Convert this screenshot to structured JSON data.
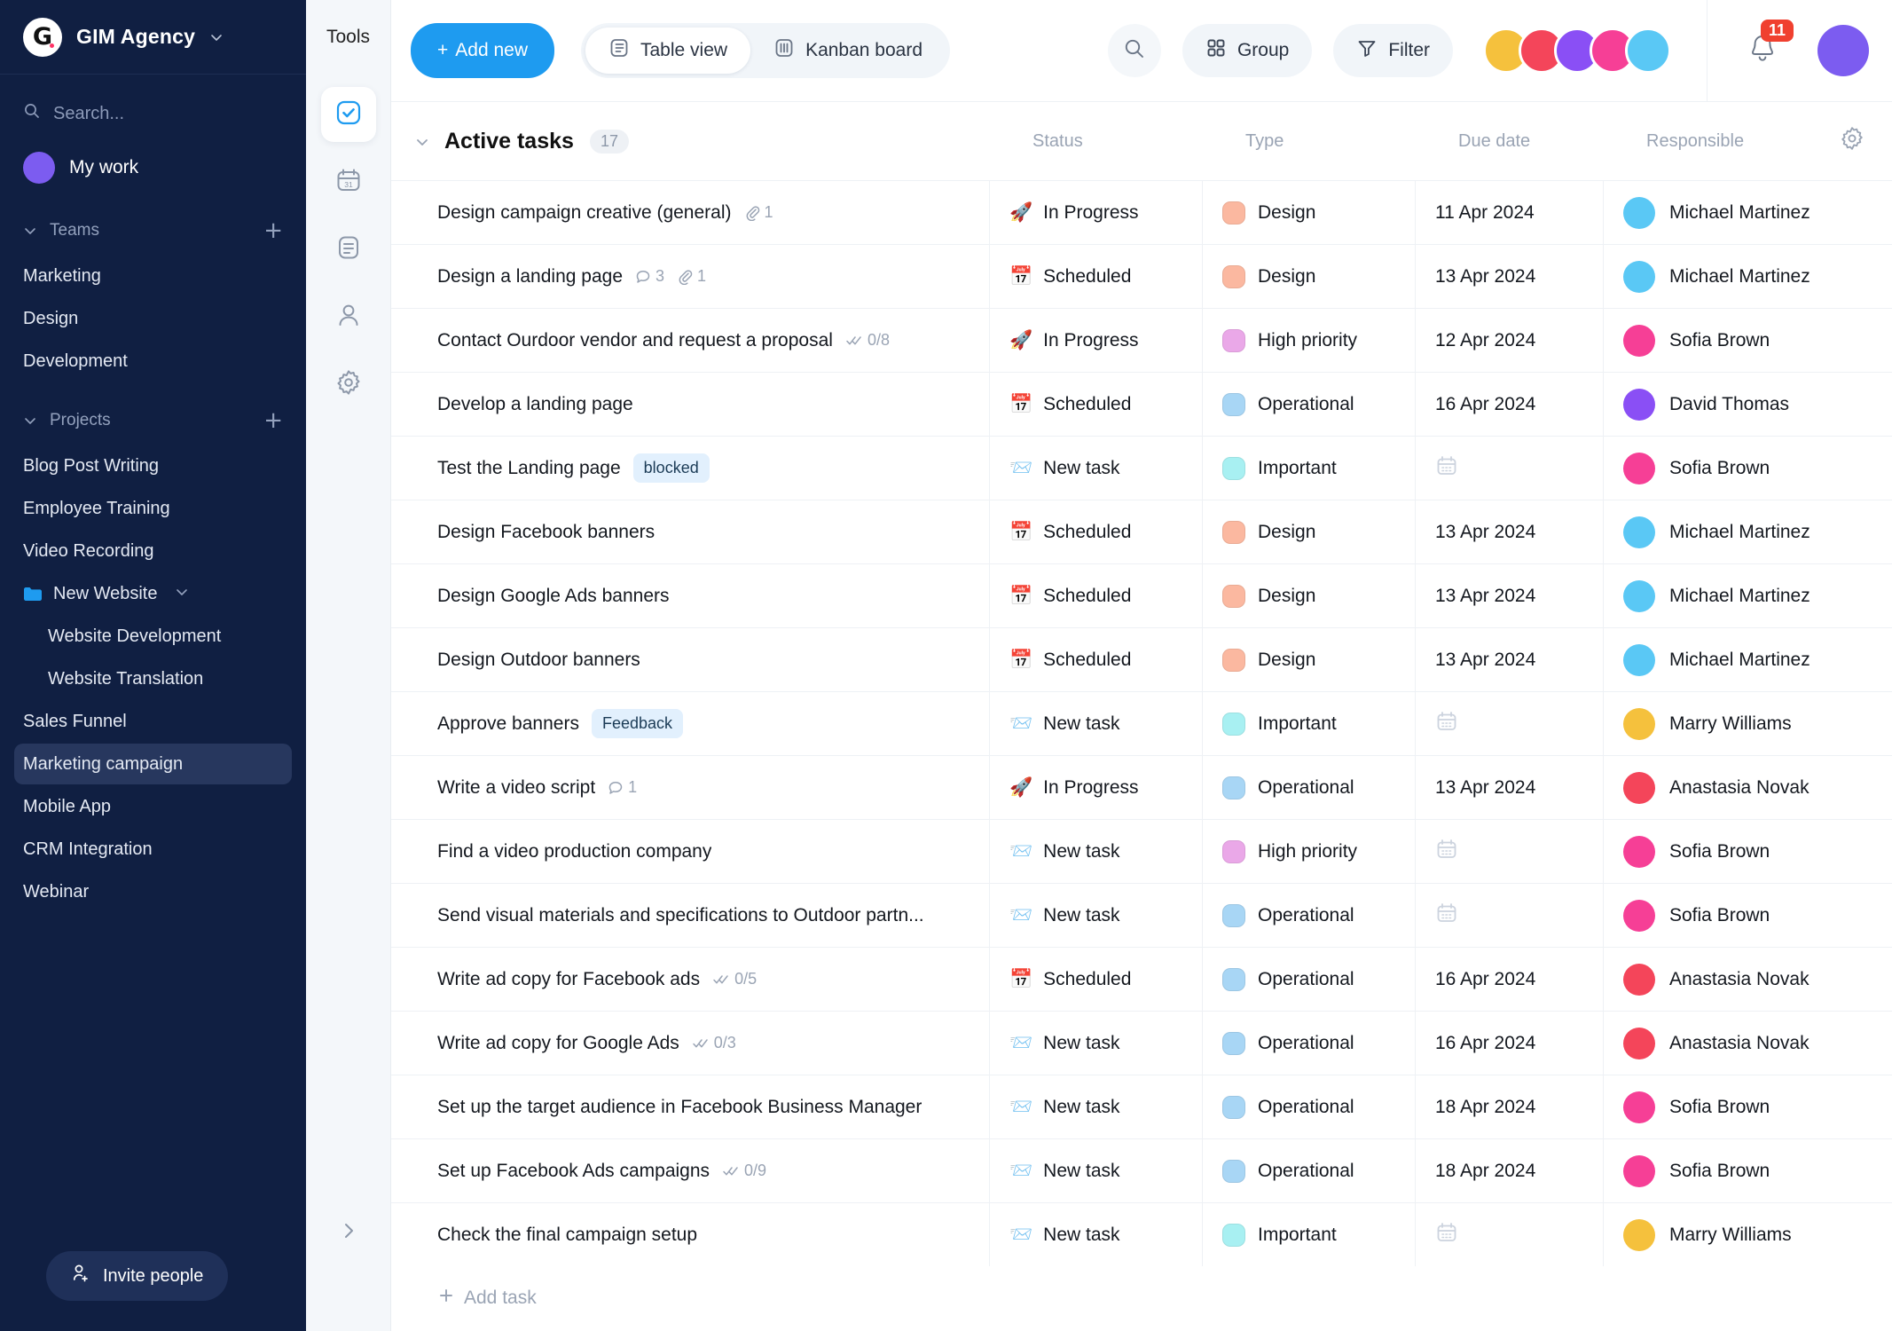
{
  "sidebar": {
    "brand": {
      "logo_letter": "G",
      "name": "GIM Agency",
      "chevron_icon": "chevron-down-icon"
    },
    "search": {
      "placeholder": "Search...",
      "icon": "search-icon"
    },
    "my_work": {
      "label": "My work",
      "avatar_color": "#7c5cf0"
    },
    "teams": {
      "label": "Teams",
      "add_label": "+",
      "items": [
        {
          "label": "Marketing"
        },
        {
          "label": "Design"
        },
        {
          "label": "Development"
        }
      ]
    },
    "projects": {
      "label": "Projects",
      "add_label": "+",
      "items": [
        {
          "label": "Blog Post Writing",
          "level": 0,
          "folder": false,
          "active": false
        },
        {
          "label": "Employee Training",
          "level": 0,
          "folder": false,
          "active": false
        },
        {
          "label": "Video Recording",
          "level": 0,
          "folder": false,
          "active": false
        },
        {
          "label": "New Website",
          "level": 0,
          "folder": true,
          "active": false
        },
        {
          "label": "Website Development",
          "level": 1,
          "folder": false,
          "active": false
        },
        {
          "label": "Website Translation",
          "level": 1,
          "folder": false,
          "active": false
        },
        {
          "label": "Sales Funnel",
          "level": 0,
          "folder": false,
          "active": false
        },
        {
          "label": "Marketing campaign",
          "level": 0,
          "folder": false,
          "active": true
        },
        {
          "label": "Mobile App",
          "level": 0,
          "folder": false,
          "active": false
        },
        {
          "label": "CRM Integration",
          "level": 0,
          "folder": false,
          "active": false
        },
        {
          "label": "Webinar",
          "level": 0,
          "folder": false,
          "active": false
        }
      ]
    },
    "invite": {
      "label": "Invite people",
      "icon": "add-person-icon"
    }
  },
  "rail": {
    "title": "Tools",
    "items": [
      {
        "icon": "checkbox-tasks-icon",
        "selected": true
      },
      {
        "icon": "calendar-31-icon",
        "selected": false
      },
      {
        "icon": "document-icon",
        "selected": false
      },
      {
        "icon": "person-icon",
        "selected": false
      },
      {
        "icon": "gear-icon",
        "selected": false
      }
    ],
    "collapse_icon": "chevron-right-icon"
  },
  "topbar": {
    "add_new": {
      "label": "Add new",
      "plus": "+"
    },
    "views": [
      {
        "label": "Table view",
        "icon": "table-view-icon",
        "active": true
      },
      {
        "label": "Kanban board",
        "icon": "kanban-board-icon",
        "active": false
      }
    ],
    "search_icon": "search-icon",
    "group": {
      "label": "Group",
      "icon": "grid-icon"
    },
    "filter": {
      "label": "Filter",
      "icon": "funnel-icon"
    },
    "member_avatars": [
      "#f5c13d",
      "#f4455a",
      "#8a4ff5",
      "#f63f96",
      "#5ac8f5"
    ],
    "bell": {
      "icon": "bell-icon",
      "count": "11",
      "badge_color": "#f0402f"
    },
    "profile_avatar": {
      "color": "#7c5cf0"
    },
    "accent_color": "#1e9bf0"
  },
  "table": {
    "section_title": "Active tasks",
    "section_count": "17",
    "collapse_icon": "chevron-down-icon",
    "settings_icon": "gear-icon",
    "columns": [
      "",
      "Status",
      "Type",
      "Due date",
      "Responsible"
    ],
    "add_task_label": "Add task",
    "type_colors": {
      "Design": "#fbb8a0",
      "High priority": "#eaa8e8",
      "Operational": "#a8d6f5",
      "Important": "#a8f0f2"
    },
    "rows": [
      {
        "name": "Design campaign creative (general)",
        "tag": "",
        "comments": "",
        "attachments": "1",
        "checklist": "",
        "status": "In Progress",
        "status_icon": "rocket",
        "type": "Design",
        "due": "11 Apr 2024",
        "responsible": "Michael Martinez",
        "avatar_color": "#5ac8f5"
      },
      {
        "name": "Design a landing page",
        "tag": "",
        "comments": "3",
        "attachments": "1",
        "checklist": "",
        "status": "Scheduled",
        "status_icon": "calendar",
        "type": "Design",
        "due": "13 Apr 2024",
        "responsible": "Michael Martinez",
        "avatar_color": "#5ac8f5"
      },
      {
        "name": "Contact Ourdoor vendor and request a proposal",
        "tag": "",
        "comments": "",
        "attachments": "",
        "checklist": "0/8",
        "status": "In Progress",
        "status_icon": "rocket",
        "type": "High priority",
        "due": "12 Apr 2024",
        "responsible": "Sofia Brown",
        "avatar_color": "#f63f96"
      },
      {
        "name": "Develop a landing page",
        "tag": "",
        "comments": "",
        "attachments": "",
        "checklist": "",
        "status": "Scheduled",
        "status_icon": "calendar",
        "type": "Operational",
        "due": "16 Apr 2024",
        "responsible": "David Thomas",
        "avatar_color": "#8a4ff5"
      },
      {
        "name": "Test the Landing page",
        "tag": "blocked",
        "comments": "",
        "attachments": "",
        "checklist": "",
        "status": "New task",
        "status_icon": "envelope",
        "type": "Important",
        "due": "",
        "responsible": "Sofia Brown",
        "avatar_color": "#f63f96"
      },
      {
        "name": "Design Facebook banners",
        "tag": "",
        "comments": "",
        "attachments": "",
        "checklist": "",
        "status": "Scheduled",
        "status_icon": "calendar",
        "type": "Design",
        "due": "13 Apr 2024",
        "responsible": "Michael Martinez",
        "avatar_color": "#5ac8f5"
      },
      {
        "name": "Design Google Ads banners",
        "tag": "",
        "comments": "",
        "attachments": "",
        "checklist": "",
        "status": "Scheduled",
        "status_icon": "calendar",
        "type": "Design",
        "due": "13 Apr 2024",
        "responsible": "Michael Martinez",
        "avatar_color": "#5ac8f5"
      },
      {
        "name": "Design Outdoor banners",
        "tag": "",
        "comments": "",
        "attachments": "",
        "checklist": "",
        "status": "Scheduled",
        "status_icon": "calendar",
        "type": "Design",
        "due": "13 Apr 2024",
        "responsible": "Michael Martinez",
        "avatar_color": "#5ac8f5"
      },
      {
        "name": "Approve banners",
        "tag": "Feedback",
        "comments": "",
        "attachments": "",
        "checklist": "",
        "status": "New task",
        "status_icon": "envelope",
        "type": "Important",
        "due": "",
        "responsible": "Marry Williams",
        "avatar_color": "#f5c13d"
      },
      {
        "name": "Write a video script",
        "tag": "",
        "comments": "1",
        "attachments": "",
        "checklist": "",
        "status": "In Progress",
        "status_icon": "rocket",
        "type": "Operational",
        "due": "13 Apr 2024",
        "responsible": "Anastasia Novak",
        "avatar_color": "#f4455a"
      },
      {
        "name": "Find a video production company",
        "tag": "",
        "comments": "",
        "attachments": "",
        "checklist": "",
        "status": "New task",
        "status_icon": "envelope",
        "type": "High priority",
        "due": "",
        "responsible": "Sofia Brown",
        "avatar_color": "#f63f96"
      },
      {
        "name": "Send visual materials and specifications to Outdoor partn...",
        "tag": "",
        "comments": "",
        "attachments": "",
        "checklist": "",
        "status": "New task",
        "status_icon": "envelope",
        "type": "Operational",
        "due": "",
        "responsible": "Sofia Brown",
        "avatar_color": "#f63f96"
      },
      {
        "name": "Write ad copy for Facebook ads",
        "tag": "",
        "comments": "",
        "attachments": "",
        "checklist": "0/5",
        "status": "Scheduled",
        "status_icon": "calendar",
        "type": "Operational",
        "due": "16 Apr 2024",
        "responsible": "Anastasia Novak",
        "avatar_color": "#f4455a"
      },
      {
        "name": "Write ad copy for Google Ads",
        "tag": "",
        "comments": "",
        "attachments": "",
        "checklist": "0/3",
        "status": "New task",
        "status_icon": "envelope",
        "type": "Operational",
        "due": "16 Apr 2024",
        "responsible": "Anastasia Novak",
        "avatar_color": "#f4455a"
      },
      {
        "name": "Set up the target audience in Facebook Business Manager",
        "tag": "",
        "comments": "",
        "attachments": "",
        "checklist": "",
        "status": "New task",
        "status_icon": "envelope",
        "type": "Operational",
        "due": "18 Apr 2024",
        "responsible": "Sofia Brown",
        "avatar_color": "#f63f96"
      },
      {
        "name": "Set up Facebook Ads campaigns",
        "tag": "",
        "comments": "",
        "attachments": "",
        "checklist": "0/9",
        "status": "New task",
        "status_icon": "envelope",
        "type": "Operational",
        "due": "18 Apr 2024",
        "responsible": "Sofia Brown",
        "avatar_color": "#f63f96"
      },
      {
        "name": "Check the final campaign setup",
        "tag": "",
        "comments": "",
        "attachments": "",
        "checklist": "",
        "status": "New task",
        "status_icon": "envelope",
        "type": "Important",
        "due": "",
        "responsible": "Marry Williams",
        "avatar_color": "#f5c13d"
      }
    ]
  }
}
